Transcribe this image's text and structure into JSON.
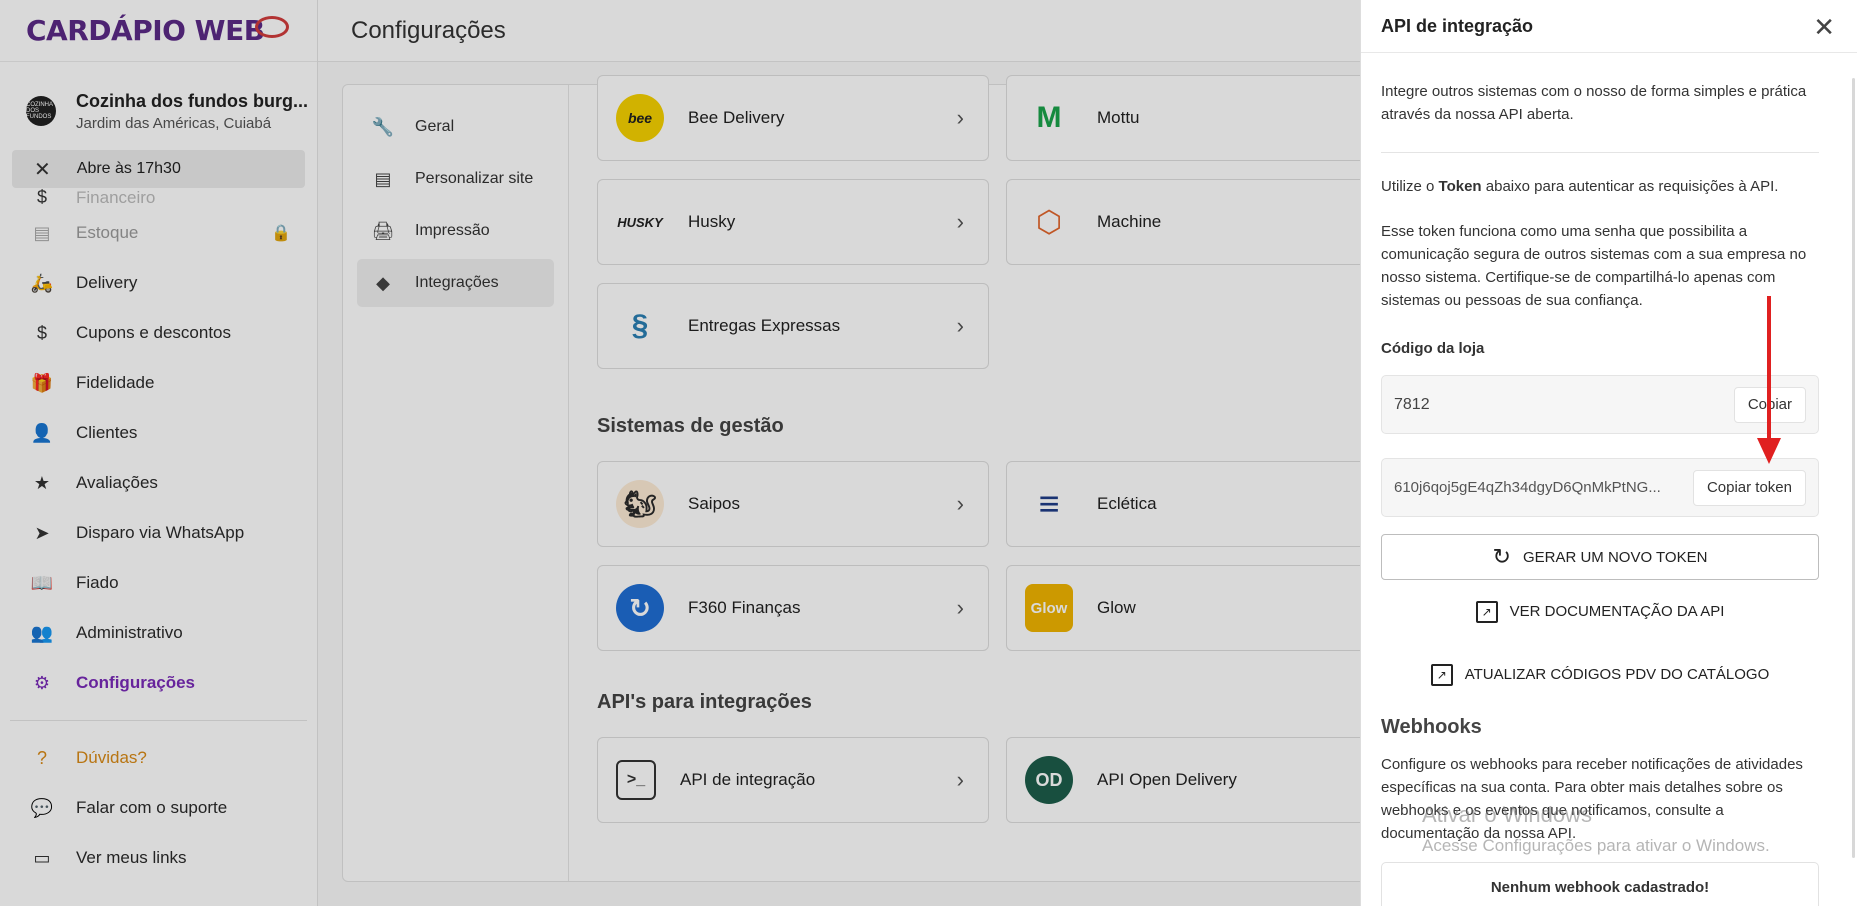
{
  "brand": {
    "logo": "CARDÁPIO WEB"
  },
  "store": {
    "name": "Cozinha dos fundos burg...",
    "address": "Jardim das Américas, Cuiabá",
    "avatar_text": "COZINHA DOS FUNDOS"
  },
  "status": {
    "text": "Abre às 17h30"
  },
  "menu": {
    "items": [
      {
        "label": "Financeiro"
      },
      {
        "label": "Estoque"
      },
      {
        "label": "Delivery"
      },
      {
        "label": "Cupons e descontos"
      },
      {
        "label": "Fidelidade"
      },
      {
        "label": "Clientes"
      },
      {
        "label": "Avaliações"
      },
      {
        "label": "Disparo via WhatsApp"
      },
      {
        "label": "Fiado"
      },
      {
        "label": "Administrativo"
      },
      {
        "label": "Configurações"
      },
      {
        "label": "Dúvidas?"
      },
      {
        "label": "Falar com o suporte"
      },
      {
        "label": "Ver meus links"
      }
    ]
  },
  "main": {
    "title": "Configurações",
    "subnav": [
      {
        "label": "Geral"
      },
      {
        "label": "Personalizar site"
      },
      {
        "label": "Impressão"
      },
      {
        "label": "Integrações"
      }
    ],
    "integrations": {
      "delivery": [
        {
          "name": "Bee Delivery",
          "logo_text": "bee"
        },
        {
          "name": "Mottu",
          "logo_text": "M"
        },
        {
          "name": "Husky",
          "logo_text": "HUSKY"
        },
        {
          "name": "Machine",
          "logo_text": "⬡"
        },
        {
          "name": "Entregas Expressas",
          "logo_text": "§"
        }
      ],
      "management_title": "Sistemas de gestão",
      "management": [
        {
          "name": "Saipos",
          "logo_text": "🐿"
        },
        {
          "name": "Eclética",
          "logo_text": "≡"
        },
        {
          "name": "F360 Finanças",
          "logo_text": "↻"
        },
        {
          "name": "Glow",
          "logo_text": "Glow"
        }
      ],
      "api_title": "API's para integrações",
      "api": [
        {
          "name": "API de integração",
          "logo_text": ">_"
        },
        {
          "name": "API Open Delivery",
          "logo_text": "OD"
        }
      ]
    }
  },
  "drawer": {
    "title": "API de integração",
    "intro": "Integre outros sistemas com o nosso de forma simples e prática através da nossa API aberta.",
    "token_prefix": "Utilize o",
    "token_bold": "Token",
    "token_suffix": "abaixo para autenticar as requisições à API.",
    "token_warning": "Esse token funciona como uma senha que possibilita a comunicação segura de outros sistemas com a sua empresa no nosso sistema. Certifique-se de compartilhá-lo apenas com sistemas ou pessoas de sua confiança.",
    "store_code_label": "Código da loja",
    "store_code": "7812",
    "copy_label": "Copiar",
    "token_value": "610j6qoj5gE4qZh34dgyD6QnMkPtNG...",
    "copy_token_label": "Copiar token",
    "generate_label": "GERAR UM NOVO TOKEN",
    "docs_label": "VER DOCUMENTAÇÃO DA API",
    "update_codes_label": "ATUALIZAR CÓDIGOS PDV DO CATÁLOGO",
    "webhooks_title": "Webhooks",
    "webhooks_desc": "Configure os webhooks para receber notificações de atividades específicas na sua conta. Para obter mais detalhes sobre os webhooks e os eventos que notificamos, consulte a documentação da nossa API.",
    "no_webhook": "Nenhum webhook cadastrado!"
  },
  "watermark": {
    "line1": "Ativar o Windows",
    "line2": "Acesse Configurações para ativar o Windows."
  },
  "colors": {
    "brand": "#5b2a86",
    "active": "#7a2bb8",
    "help": "#d98a16",
    "arrow": "#e02020"
  }
}
